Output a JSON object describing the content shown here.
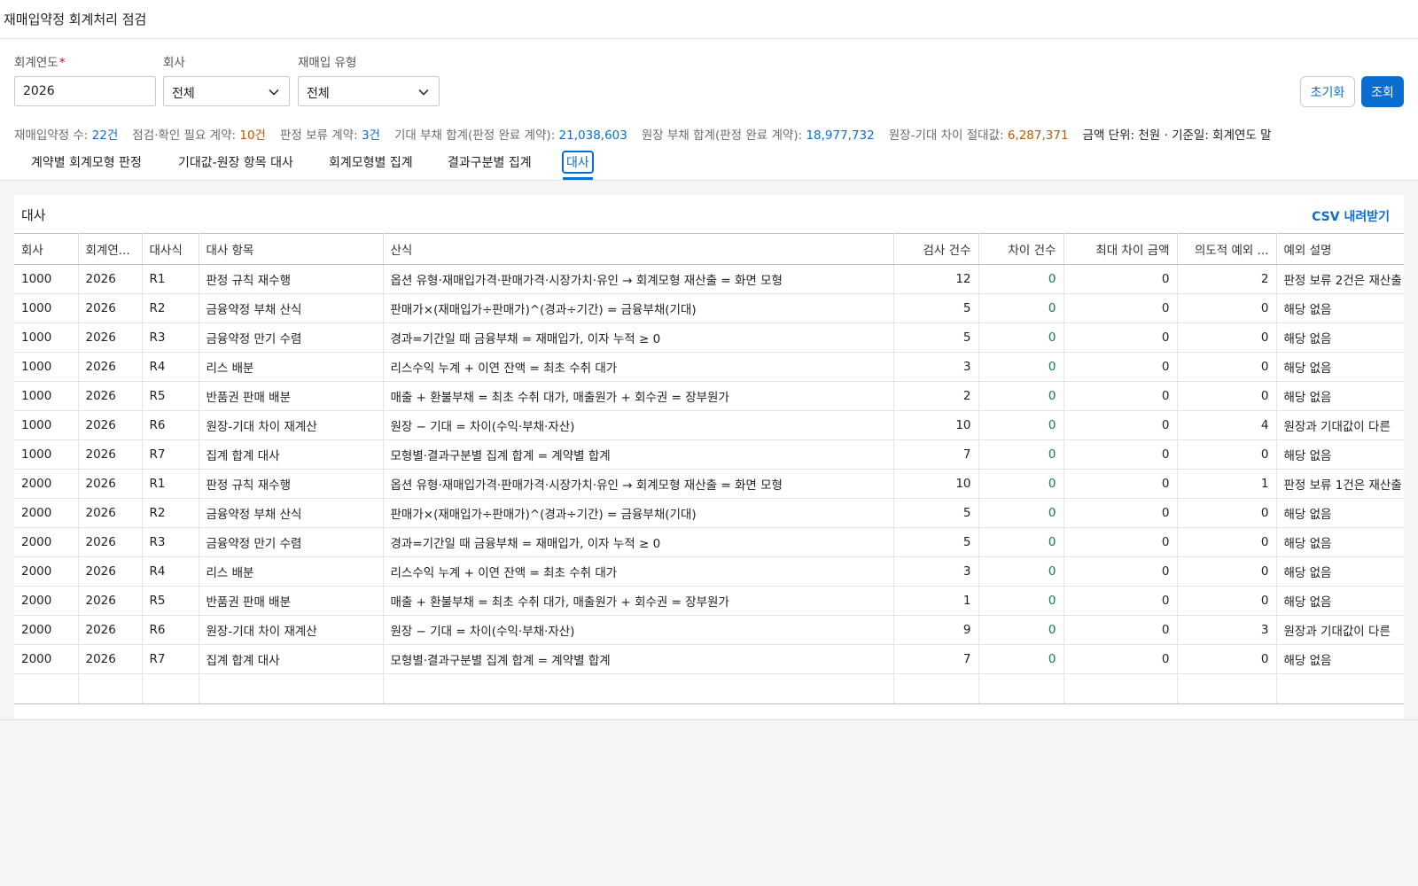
{
  "app": {
    "title": "재매입약정 회계처리 점검"
  },
  "filters": {
    "fiscal_year": {
      "label": "회계연도",
      "required_mark": "*",
      "value": "2026"
    },
    "company": {
      "label": "회사",
      "value": "전체"
    },
    "repurchase_type": {
      "label": "재매입 유형",
      "value": "전체"
    }
  },
  "buttons": {
    "reset": "초기화",
    "search": "조회"
  },
  "kpis": {
    "contracts_label": "재매입약정 수:",
    "contracts_value": "22건",
    "review_label": "점검·확인 필요 계약:",
    "review_value": "10건",
    "hold_label": "판정 보류 계약:",
    "hold_value": "3건",
    "expected_label": "기대 부채 합계(판정 완료 계약):",
    "expected_value": "21,038,603",
    "ledger_label": "원장 부채 합계(판정 완료 계약):",
    "ledger_value": "18,977,732",
    "diff_label": "원장-기대 차이 절대값:",
    "diff_value": "6,287,371",
    "unit_note": "금액 단위: 천원 · 기준일: 회계연도 말"
  },
  "tabs": [
    "계약별 회계모형 판정",
    "기대값-원장 항목 대사",
    "회계모형별 집계",
    "결과구분별 집계",
    "대사"
  ],
  "active_tab": 4,
  "panel": {
    "title": "대사",
    "csv_label": "CSV 내려받기"
  },
  "table": {
    "headers": [
      "회사",
      "회계연...",
      "대사식",
      "대사 항목",
      "산식",
      "검사 건수",
      "차이 건수",
      "최대 차이 금액",
      "의도적 예외 ...",
      "예외 설명"
    ],
    "rows": [
      [
        "1000",
        "2026",
        "R1",
        "판정 규칙 재수행",
        "옵션 유형·재매입가격·판매가격·시장가치·유인 → 회계모형 재산출 = 화면 모형",
        "12",
        "0",
        "0",
        "2",
        "판정 보류 2건은 재산출"
      ],
      [
        "1000",
        "2026",
        "R2",
        "금융약정 부채 산식",
        "판매가×(재매입가÷판매가)^(경과÷기간) = 금융부채(기대)",
        "5",
        "0",
        "0",
        "0",
        "해당 없음"
      ],
      [
        "1000",
        "2026",
        "R3",
        "금융약정 만기 수렴",
        "경과=기간일 때 금융부채 = 재매입가, 이자 누적 ≥ 0",
        "5",
        "0",
        "0",
        "0",
        "해당 없음"
      ],
      [
        "1000",
        "2026",
        "R4",
        "리스 배분",
        "리스수익 누계 + 이연 잔액 = 최초 수취 대가",
        "3",
        "0",
        "0",
        "0",
        "해당 없음"
      ],
      [
        "1000",
        "2026",
        "R5",
        "반품권 판매 배분",
        "매출 + 환불부채 = 최초 수취 대가, 매출원가 + 회수권 = 장부원가",
        "2",
        "0",
        "0",
        "0",
        "해당 없음"
      ],
      [
        "1000",
        "2026",
        "R6",
        "원장-기대 차이 재계산",
        "원장 − 기대 = 차이(수익·부채·자산)",
        "10",
        "0",
        "0",
        "4",
        "원장과 기대값이 다른"
      ],
      [
        "1000",
        "2026",
        "R7",
        "집계 합계 대사",
        "모형별·결과구분별 집계 합계 = 계약별 합계",
        "7",
        "0",
        "0",
        "0",
        "해당 없음"
      ],
      [
        "2000",
        "2026",
        "R1",
        "판정 규칙 재수행",
        "옵션 유형·재매입가격·판매가격·시장가치·유인 → 회계모형 재산출 = 화면 모형",
        "10",
        "0",
        "0",
        "1",
        "판정 보류 1건은 재산출"
      ],
      [
        "2000",
        "2026",
        "R2",
        "금융약정 부채 산식",
        "판매가×(재매입가÷판매가)^(경과÷기간) = 금융부채(기대)",
        "5",
        "0",
        "0",
        "0",
        "해당 없음"
      ],
      [
        "2000",
        "2026",
        "R3",
        "금융약정 만기 수렴",
        "경과=기간일 때 금융부채 = 재매입가, 이자 누적 ≥ 0",
        "5",
        "0",
        "0",
        "0",
        "해당 없음"
      ],
      [
        "2000",
        "2026",
        "R4",
        "리스 배분",
        "리스수익 누계 + 이연 잔액 = 최초 수취 대가",
        "3",
        "0",
        "0",
        "0",
        "해당 없음"
      ],
      [
        "2000",
        "2026",
        "R5",
        "반품권 판매 배분",
        "매출 + 환불부채 = 최초 수취 대가, 매출원가 + 회수권 = 장부원가",
        "1",
        "0",
        "0",
        "0",
        "해당 없음"
      ],
      [
        "2000",
        "2026",
        "R6",
        "원장-기대 차이 재계산",
        "원장 − 기대 = 차이(수익·부채·자산)",
        "9",
        "0",
        "0",
        "3",
        "원장과 기대값이 다른"
      ],
      [
        "2000",
        "2026",
        "R7",
        "집계 합계 대사",
        "모형별·결과구분별 집계 합계 = 계약별 합계",
        "7",
        "0",
        "0",
        "0",
        "해당 없음"
      ]
    ]
  },
  "colors": {
    "accent": "#0a6ed1",
    "warning": "#c35500",
    "positive": "#107e3e"
  }
}
